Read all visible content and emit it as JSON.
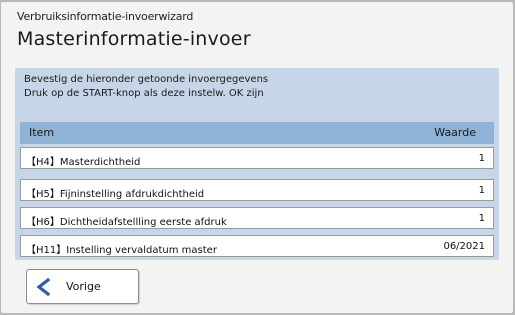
{
  "wizard_name": "Verbruiksinformatie-invoerwizard",
  "page_title": "Masterinformatie-invoer",
  "instructions": [
    "Bevestig de hieronder getoonde invoergegevens",
    "Druk op de START-knop als deze instelw. OK zijn"
  ],
  "table": {
    "headers": {
      "item": "Item",
      "value": "Waarde"
    },
    "rows": [
      {
        "code": "【H4】",
        "label": "Masterdichtheid",
        "value": "1"
      },
      {
        "code": "【H5】",
        "label": "Fijninstelling afdrukdichtheid",
        "value": "1"
      },
      {
        "code": "【H6】",
        "label": "Dichtheidafstellling eerste afdruk",
        "value": "1"
      },
      {
        "code": "【H11】",
        "label": "Instelling vervaldatum master",
        "value": "06/2021"
      }
    ]
  },
  "back_button": {
    "label": "Vorige",
    "icon": "chevron-left-icon"
  },
  "colors": {
    "panel": "#c6d6e8",
    "table_header": "#8fb3d7",
    "back_chevron": "#2f5fa7"
  }
}
